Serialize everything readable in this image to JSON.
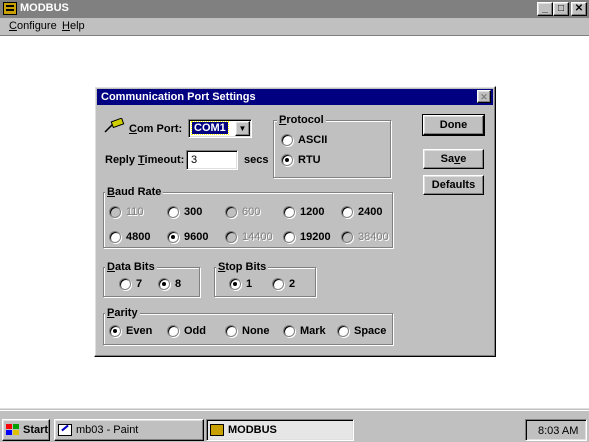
{
  "app": {
    "title": "MODBUS"
  },
  "window_controls": {
    "minimize": "_",
    "maximize": "□",
    "close": "✕"
  },
  "menu": [
    {
      "label": "Configure",
      "accel": "C",
      "rest": "onfigure"
    },
    {
      "label": "Help",
      "accel": "H",
      "rest": "elp"
    }
  ],
  "dialog": {
    "title": "Communication Port Settings",
    "close_glyph": "✕",
    "com_port": {
      "label_accel": "C",
      "label_rest": "om Port:",
      "value": "COM1",
      "arrow": "▼"
    },
    "reply_timeout": {
      "label_pre": "Reply ",
      "label_accel": "T",
      "label_rest": "imeout:",
      "value": "3",
      "unit": "secs"
    },
    "protocol": {
      "label_accel": "P",
      "label_rest": "rotocol",
      "options": [
        {
          "label": "ASCII",
          "selected": false
        },
        {
          "label": "RTU",
          "selected": true
        }
      ]
    },
    "baud_rate": {
      "label_accel": "B",
      "label_rest": "aud Rate",
      "options": [
        {
          "label": "110",
          "selected": false,
          "disabled": true
        },
        {
          "label": "300",
          "selected": false,
          "disabled": false
        },
        {
          "label": "600",
          "selected": false,
          "disabled": true
        },
        {
          "label": "1200",
          "selected": false,
          "disabled": false
        },
        {
          "label": "2400",
          "selected": false,
          "disabled": false
        },
        {
          "label": "4800",
          "selected": false,
          "disabled": false
        },
        {
          "label": "9600",
          "selected": true,
          "disabled": false
        },
        {
          "label": "14400",
          "selected": false,
          "disabled": true
        },
        {
          "label": "19200",
          "selected": false,
          "disabled": false
        },
        {
          "label": "38400",
          "selected": false,
          "disabled": true
        }
      ]
    },
    "data_bits": {
      "label_accel": "D",
      "label_rest": "ata Bits",
      "options": [
        {
          "label": "7",
          "selected": false
        },
        {
          "label": "8",
          "selected": true
        }
      ]
    },
    "stop_bits": {
      "label_accel": "S",
      "label_rest": "top Bits",
      "options": [
        {
          "label": "1",
          "selected": true
        },
        {
          "label": "2",
          "selected": false
        }
      ]
    },
    "parity": {
      "label_accel": "P",
      "label_rest": "arity",
      "options": [
        {
          "label": "Even",
          "selected": true
        },
        {
          "label": "Odd",
          "selected": false
        },
        {
          "label": "None",
          "selected": false
        },
        {
          "label": "Mark",
          "selected": false
        },
        {
          "label": "Space",
          "selected": false
        }
      ]
    },
    "buttons": {
      "done": "Done",
      "save_pre": "Sa",
      "save_accel": "v",
      "save_rest": "e",
      "defaults": "Defaults"
    }
  },
  "taskbar": {
    "start": "Start",
    "tasks": [
      {
        "label": "mb03 - Paint",
        "active": false
      },
      {
        "label": "MODBUS",
        "active": true
      }
    ],
    "clock": "8:03 AM"
  },
  "colors": {
    "desktop": "#ffffff",
    "face": "#c0c0c0",
    "inactive_title": "#808080",
    "active_title": "#000080",
    "disabled_text": "#808080"
  }
}
